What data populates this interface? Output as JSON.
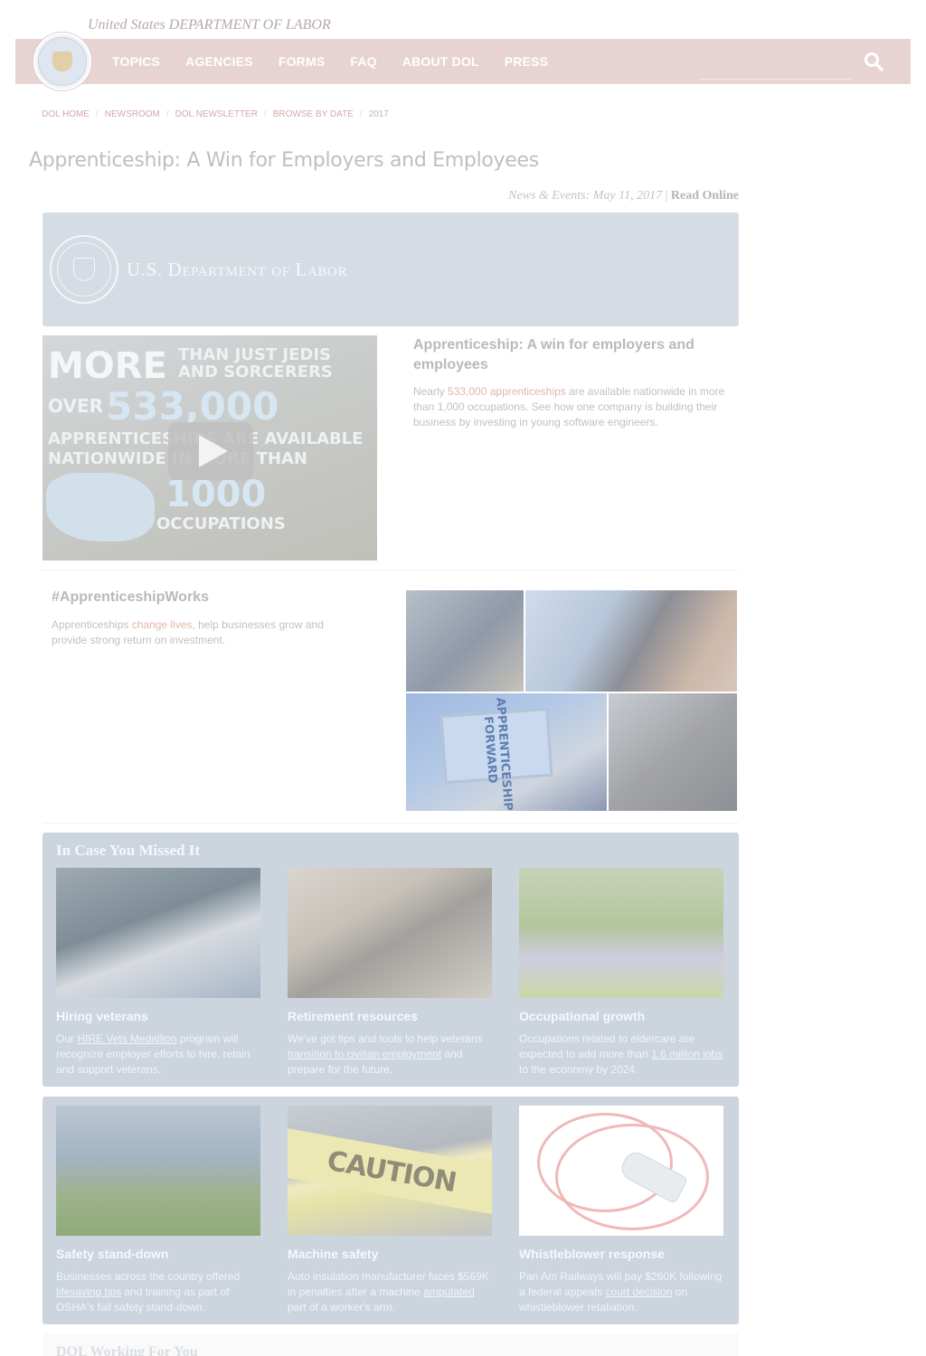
{
  "header": {
    "agency_line": "United States DEPARTMENT OF LABOR",
    "nav": [
      "TOPICS",
      "AGENCIES",
      "FORMS",
      "FAQ",
      "ABOUT DOL",
      "PRESS"
    ],
    "search_placeholder": ""
  },
  "breadcrumb": [
    "DOL HOME",
    "NEWSROOM",
    "DOL NEWSLETTER",
    "BROWSE BY DATE",
    "2017"
  ],
  "page_title": "Apprenticeship: A Win for Employers and Employees",
  "dateline": {
    "label": "News & Events: May 11, 2017",
    "separator": "|",
    "read_online": "Read Online"
  },
  "banner": {
    "text": "U.S. Department of Labor"
  },
  "video": {
    "line1": "MORE",
    "line1b": "THAN JUST JEDIS",
    "line1c": "AND SORCERERS",
    "line2a": "OVER",
    "line2b": "533,000",
    "line3": "APPRENTICESHIPS ARE AVAILABLE",
    "line4": "NATIONWIDE IN MORE THAN",
    "line5": "1000",
    "line6": "OCCUPATIONS"
  },
  "feature": {
    "title": "Apprenticeship: A win for employers and employees",
    "text_before": "Nearly ",
    "link": "533,000 apprenticeships",
    "text_after": " are available nationwide in more than 1,000 occupations. See how one company is building their business by investing in young software engineers."
  },
  "hashtag": {
    "title": "#ApprenticeshipWorks",
    "text_before": "Apprenticeships ",
    "link": "change lives",
    "text_after": ", help businesses grow and provide strong return on investment.",
    "collage_sign": "APPRENTICESHIP FORWARD"
  },
  "icym": {
    "heading": "In Case You Missed It",
    "cards": [
      {
        "title": "Hiring veterans",
        "t1": "Our ",
        "link": "HIRE Vets Medallion",
        "t2": " program will recognize employer efforts to hire, retain and support veterans."
      },
      {
        "title": "Retirement resources",
        "t1": "We've got tips and tools to help veterans ",
        "link": "transition to civilian employment",
        "t2": " and prepare for the future."
      },
      {
        "title": "Occupational growth",
        "t1": "Occupations related to eldercare are expected to add more than ",
        "link": "1.6 million jobs",
        "t2": " to the economy by 2024."
      },
      {
        "title": "Safety stand-down",
        "t1": "Businesses across the country offered ",
        "link": "lifesaving tips",
        "t2": " and training as part of OSHA's fall safety stand-down."
      },
      {
        "title": "Machine safety",
        "t1": "Auto insulation manufacturer faces $569K in penalties after a machine ",
        "link": "amputated",
        "t2": " part of a worker's arm."
      },
      {
        "title": "Whistleblower response",
        "t1": "Pan Am Railways will pay $260K following a federal appeals ",
        "link": "court decision",
        "t2": " on whistleblower retaliation."
      }
    ],
    "caution_text": "CAUTION"
  },
  "footer_heading": "DOL Working For You"
}
